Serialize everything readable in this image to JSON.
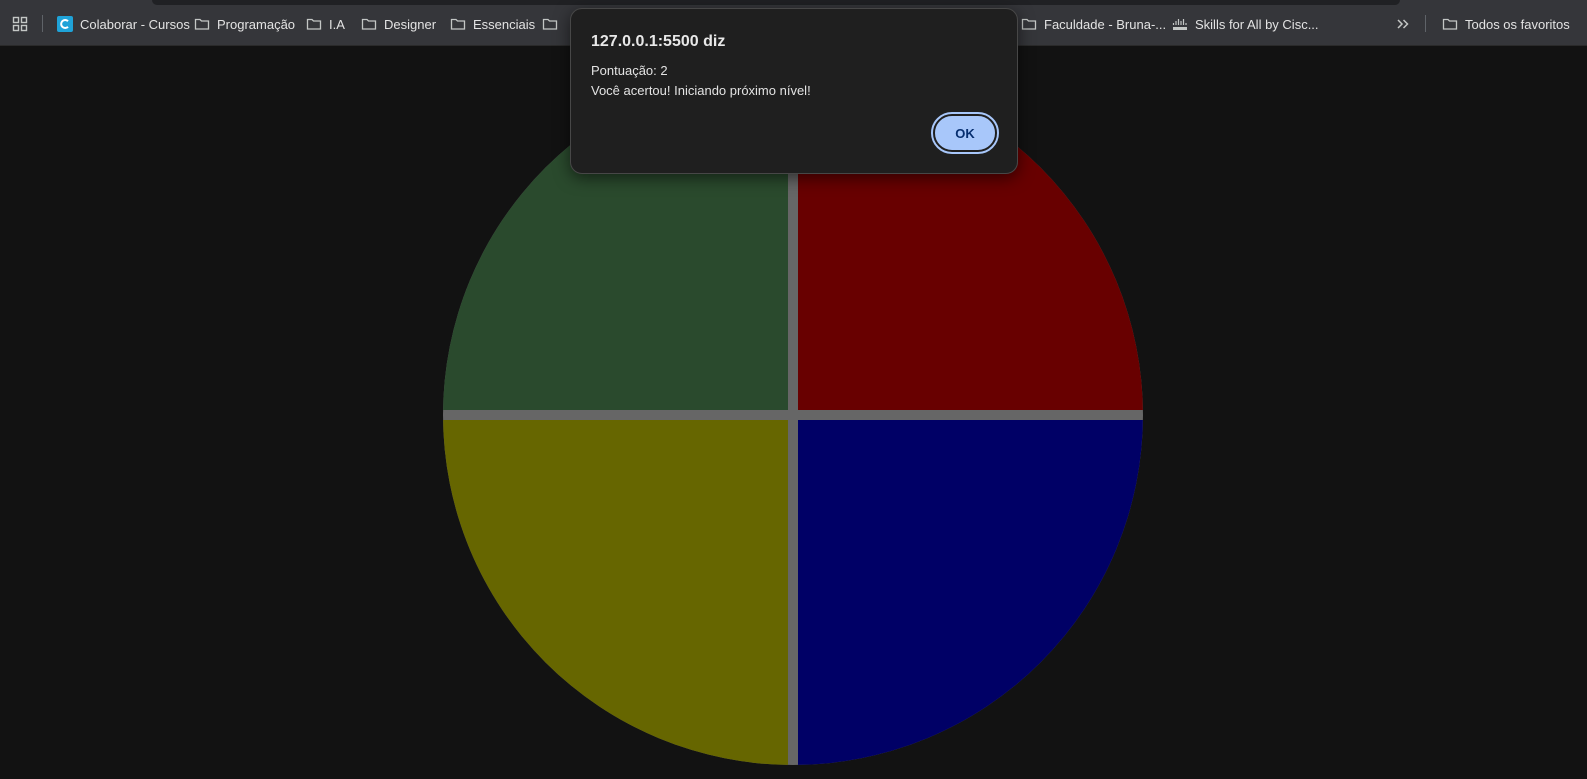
{
  "bookmarks_bar": {
    "items": [
      {
        "label": "Colaborar - Cursos",
        "icon": "colaborar-favicon"
      },
      {
        "label": "Programação",
        "icon": "folder-icon"
      },
      {
        "label": "I.A",
        "icon": "folder-icon"
      },
      {
        "label": "Designer",
        "icon": "folder-icon"
      },
      {
        "label": "Essenciais",
        "icon": "folder-icon"
      },
      {
        "label": "",
        "icon": "folder-icon"
      },
      {
        "label": "Faculdade - Bruna-...",
        "icon": "folder-icon"
      },
      {
        "label": "Skills for All by Cisc...",
        "icon": "cisco-favicon"
      }
    ],
    "overflow_icon": "chevron-double-right-icon",
    "all_bookmarks": {
      "label": "Todos os favoritos",
      "icon": "folder-icon"
    }
  },
  "dialog": {
    "title": "127.0.0.1:5500 diz",
    "line1": "Pontuação: 2",
    "line2": "Você acertou! Iniciando próximo nível!",
    "ok_label": "OK"
  },
  "game": {
    "colors": {
      "green": "#2a4a2d",
      "red": "#680000",
      "yellow": "#666600",
      "blue": "#000066",
      "divider": "#666666"
    }
  },
  "colors": {
    "page_background": "#121212",
    "toolbar_background": "#35363a",
    "dialog_background": "#1f1f1f",
    "ok_button": "#a8c7fa"
  }
}
